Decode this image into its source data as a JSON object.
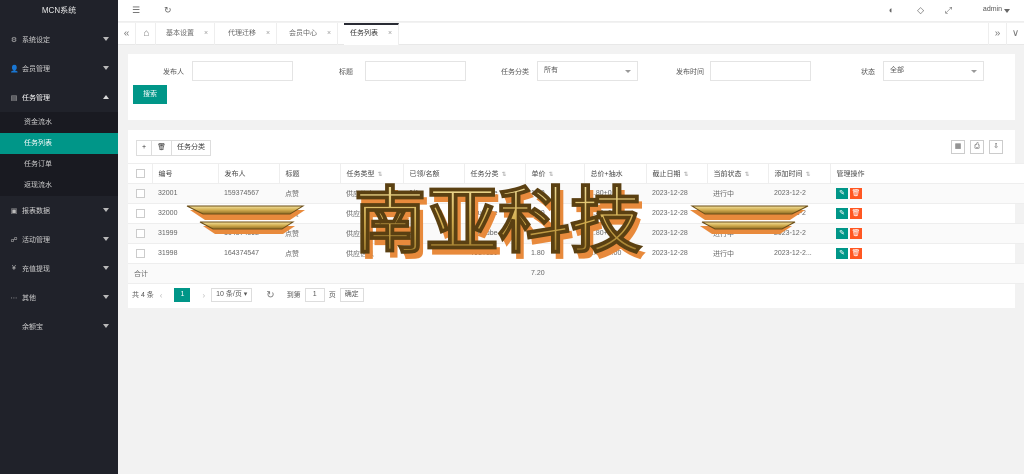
{
  "app": {
    "title": "MCN系统"
  },
  "sidebar": {
    "groups": [
      {
        "label": "系统设定",
        "icon": "gear-icon"
      },
      {
        "label": "会员管理",
        "icon": "user-icon"
      },
      {
        "label": "任务管理",
        "icon": "list-icon"
      }
    ],
    "submenu": [
      "资金流水",
      "任务列表",
      "任务订单",
      "返现流水"
    ],
    "active_sub": "任务列表",
    "groups_after": [
      {
        "label": "报表数据",
        "icon": "chart-icon"
      },
      {
        "label": "活动管理",
        "icon": "activity-icon"
      },
      {
        "label": "充值提现",
        "icon": "money-icon"
      },
      {
        "label": "其他",
        "icon": "more-icon"
      },
      {
        "label": "余额宝",
        "icon": ""
      }
    ]
  },
  "header": {
    "user": "admin"
  },
  "tabs": {
    "items": [
      "基本设置",
      "代理迁移",
      "会员中心",
      "任务列表"
    ],
    "active": "任务列表"
  },
  "search": {
    "fields": [
      {
        "label": "发布人",
        "value": ""
      },
      {
        "label": "标题",
        "value": ""
      },
      {
        "label": "任务分类",
        "value": "所有"
      },
      {
        "label": "发布时间",
        "value": ""
      },
      {
        "label": "状态",
        "value": "全部"
      }
    ],
    "button": "搜索"
  },
  "toolbar": {
    "add": "+",
    "delete": "🗑",
    "category": "任务分类"
  },
  "table": {
    "headers": [
      "编号",
      "发布人",
      "标题",
      "任务类型",
      "已领/名额",
      "任务分类",
      "单价",
      "总价+抽水",
      "截止日期",
      "当前状态",
      "添加时间",
      "管理操作"
    ],
    "rows": [
      [
        "32001",
        "159374567",
        "点赞",
        "供应信息",
        "0/1",
        "YouTube",
        "1.80",
        "1.80+0.00",
        "2023-12-28",
        "进行中",
        "2023-12-2"
      ],
      [
        "32000",
        "159374541",
        "点赞",
        "供应信息",
        "0/1",
        "YouTube",
        "1.80",
        "1.80+0.00",
        "2023-12-28",
        "进行中",
        "2023-12-2"
      ],
      [
        "31999",
        "164374592",
        "点赞",
        "供应信息",
        "0/1",
        "YouTube",
        "1.80",
        "1.80+0.00",
        "2023-12-28",
        "进行中",
        "2023-12-2"
      ],
      [
        "31998",
        "164374547",
        "点赞",
        "供应信息",
        "0/1",
        "YouTube",
        "1.80",
        "1.80+0.00",
        "2023-12-28",
        "进行中",
        "2023-12-2..."
      ]
    ],
    "total_label": "合计",
    "total_value": "7.20"
  },
  "pager": {
    "total": "共 4 条",
    "current": "1",
    "size": "10 条/页",
    "goto_label": "到第",
    "goto_value": "1",
    "page_unit": "页",
    "confirm": "确定"
  },
  "watermark": {
    "text": "南亚科技",
    "colors": {
      "gold": "#d9b85a",
      "orange": "#e88a3c"
    }
  }
}
